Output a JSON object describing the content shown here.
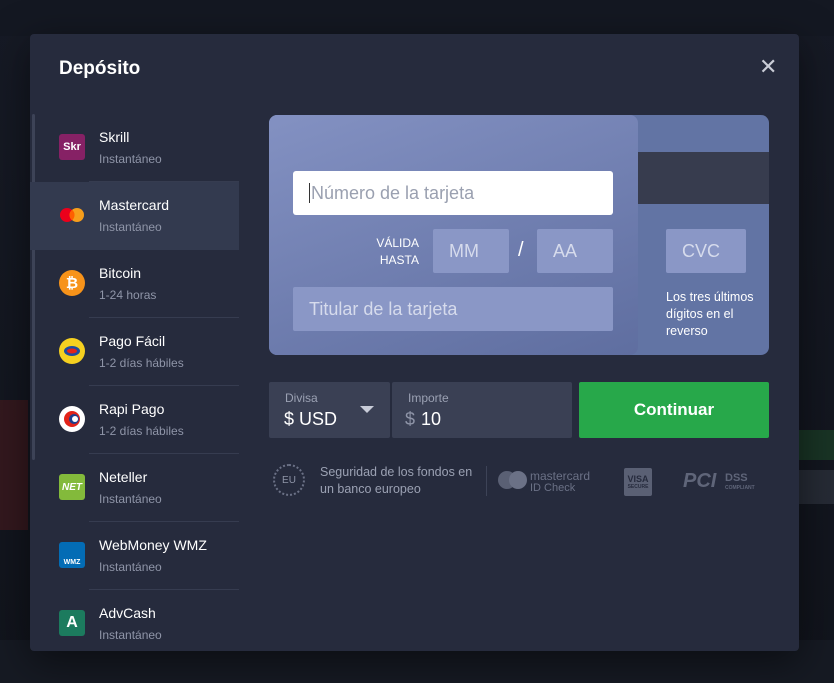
{
  "modal": {
    "title": "Depósito",
    "close_glyph": "✕"
  },
  "methods": [
    {
      "name": "Skrill",
      "sub": "Instantáneo",
      "icon": "skrill-logo",
      "icon_text": "Skr",
      "color": "#862165"
    },
    {
      "name": "Mastercard",
      "sub": "Instantáneo",
      "icon": "mastercard-logo",
      "icon_text": "",
      "color": "#333a4f",
      "active": true
    },
    {
      "name": "Bitcoin",
      "sub": "1-24 horas",
      "icon": "bitcoin-logo",
      "icon_text": "₿",
      "color": "#f7931a"
    },
    {
      "name": "Pago Fácil",
      "sub": "1-2 días hábiles",
      "icon": "pago-facil-logo",
      "icon_text": "",
      "color": "#f5d020"
    },
    {
      "name": "Rapi Pago",
      "sub": "1-2 días hábiles",
      "icon": "rapi-pago-logo",
      "icon_text": "",
      "color": "#ffffff"
    },
    {
      "name": "Neteller",
      "sub": "Instantáneo",
      "icon": "neteller-logo",
      "icon_text": "NET",
      "color": "#83ba3b"
    },
    {
      "name": "WebMoney WMZ",
      "sub": "Instantáneo",
      "icon": "webmoney-logo",
      "icon_text": "WMZ",
      "color": "#036cb5"
    },
    {
      "name": "AdvCash",
      "sub": "Instantáneo",
      "icon": "advcash-logo",
      "icon_text": "A",
      "color": "#1c7b5e"
    }
  ],
  "card": {
    "number_placeholder": "Número de la tarjeta",
    "valid_until": "VÁLIDA HASTA",
    "month_placeholder": "MM",
    "slash": "/",
    "year_placeholder": "AA",
    "holder_placeholder": "Titular de la tarjeta",
    "cvc_placeholder": "CVC",
    "cvc_help": "Los tres últimos dígitos en el reverso"
  },
  "currency": {
    "label": "Divisa",
    "value": "$ USD"
  },
  "amount": {
    "label": "Importe",
    "symbol": "$",
    "value": "10"
  },
  "continue_label": "Continuar",
  "security": {
    "eu_label": "EU",
    "text": "Seguridad de los fondos en un banco europeo",
    "mastercard_text": "mastercard",
    "mastercard_sub": "ID Check",
    "visa_text": "VISA",
    "visa_sub": "SECURE",
    "pci_text": "PCI",
    "dss_text": "DSS",
    "compliant_text": "COMPLIANT"
  },
  "colors": {
    "modal_bg": "#262b3d",
    "accent_green": "#27a84a",
    "card_blue": "#6274a4"
  }
}
